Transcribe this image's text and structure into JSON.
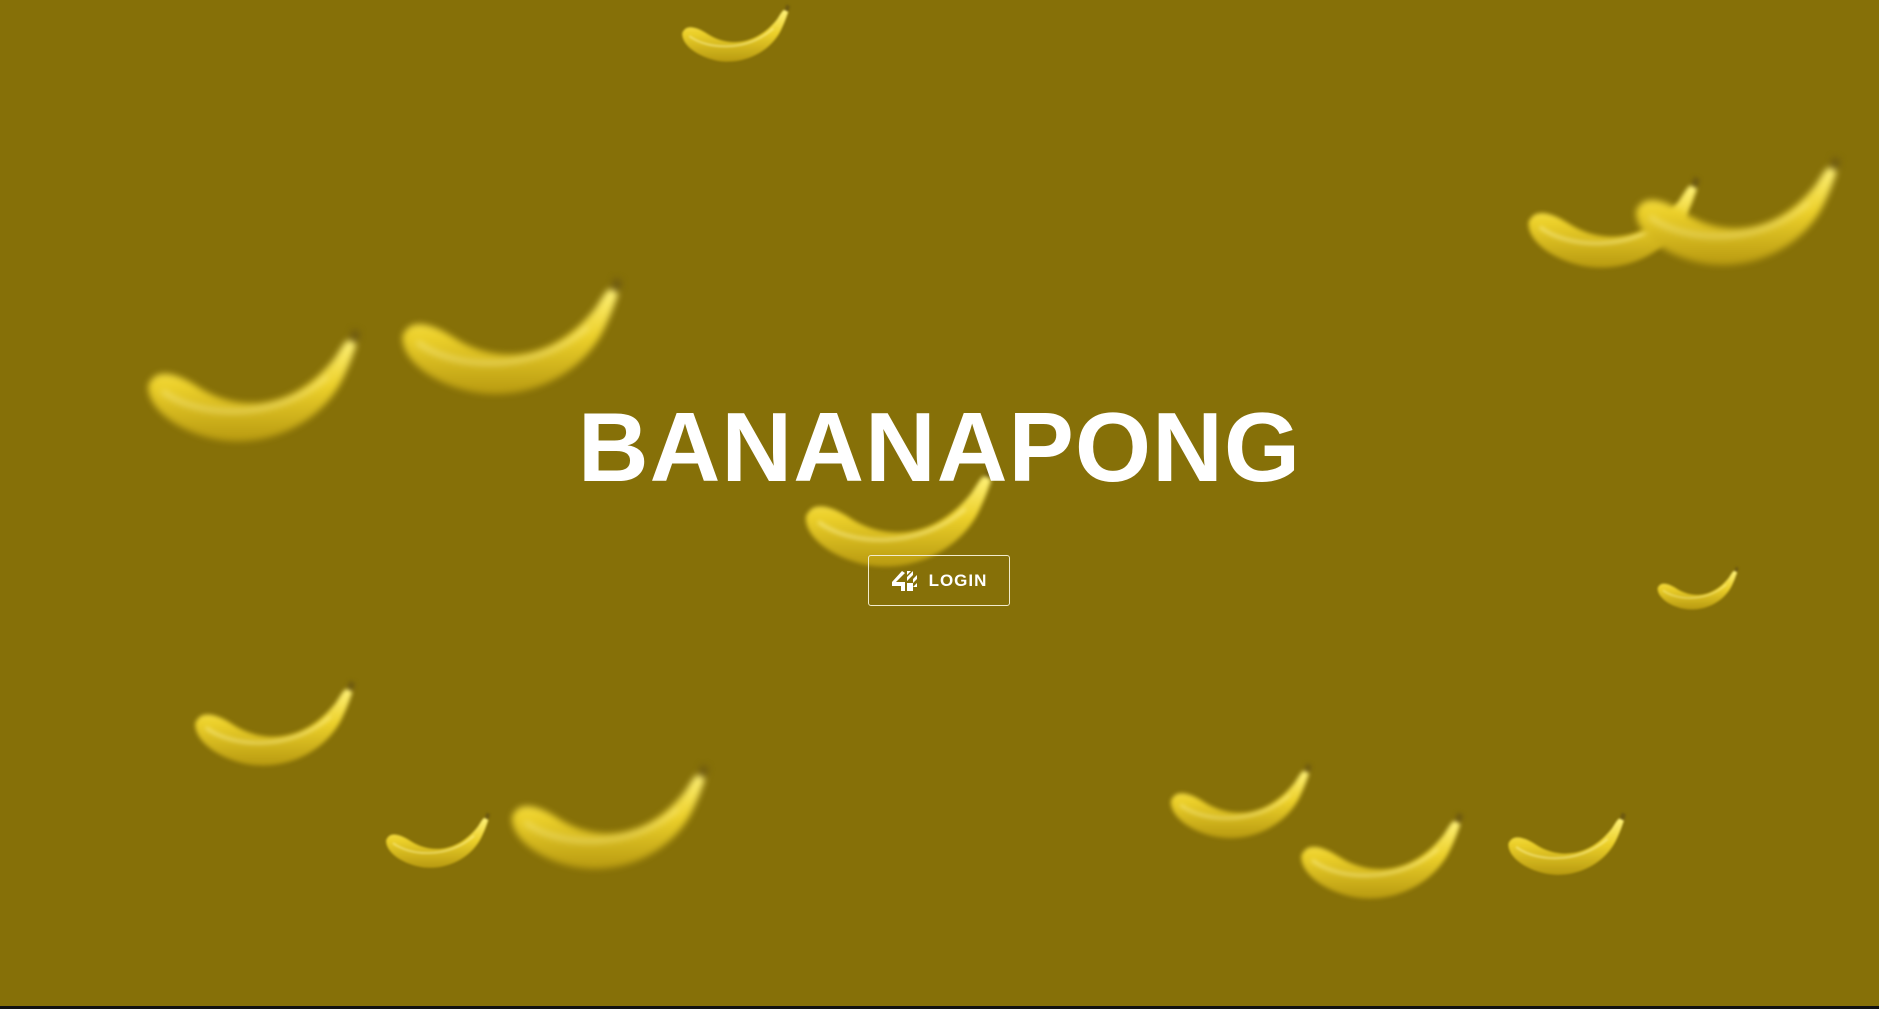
{
  "app": {
    "title": "BANANAPONG"
  },
  "auth": {
    "login_label": "LOGIN",
    "logo_icon": "42-logo-icon"
  },
  "theme": {
    "background": "#867008",
    "text": "#ffffff",
    "button_border": "#f2eccd",
    "banana_color": "#e8c61c"
  }
}
